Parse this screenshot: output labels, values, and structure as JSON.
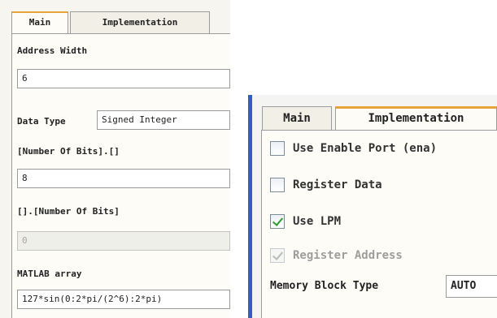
{
  "left_panel": {
    "tabs": [
      {
        "label": "Main",
        "active": true
      },
      {
        "label": "Implementation",
        "active": false
      }
    ],
    "address_width": {
      "label": "Address Width",
      "value": "6"
    },
    "data_type": {
      "label": "Data Type",
      "value": "Signed Integer"
    },
    "integer_bits": {
      "label": "[Number Of Bits].[]",
      "value": "8"
    },
    "fraction_bits": {
      "label": "[].[Number Of Bits]",
      "value": "0",
      "disabled": true
    },
    "matlab_array": {
      "label": "MATLAB array",
      "value": "127*sin(0:2*pi/(2^6):2*pi)"
    }
  },
  "right_panel": {
    "tabs": [
      {
        "label": "Main",
        "active": false
      },
      {
        "label": "Implementation",
        "active": true
      }
    ],
    "options": [
      {
        "label": "Use Enable Port (ena)",
        "checked": false,
        "disabled": false
      },
      {
        "label": "Register Data",
        "checked": false,
        "disabled": false
      },
      {
        "label": "Use LPM",
        "checked": true,
        "disabled": false
      },
      {
        "label": "Register Address",
        "checked": true,
        "disabled": true
      }
    ],
    "memory_block_type": {
      "label": "Memory Block Type",
      "value": "AUTO"
    }
  },
  "colors": {
    "accent_tab": "#e8a23a",
    "window_edge": "#2f5fbf",
    "check": "#2f9a2f"
  }
}
